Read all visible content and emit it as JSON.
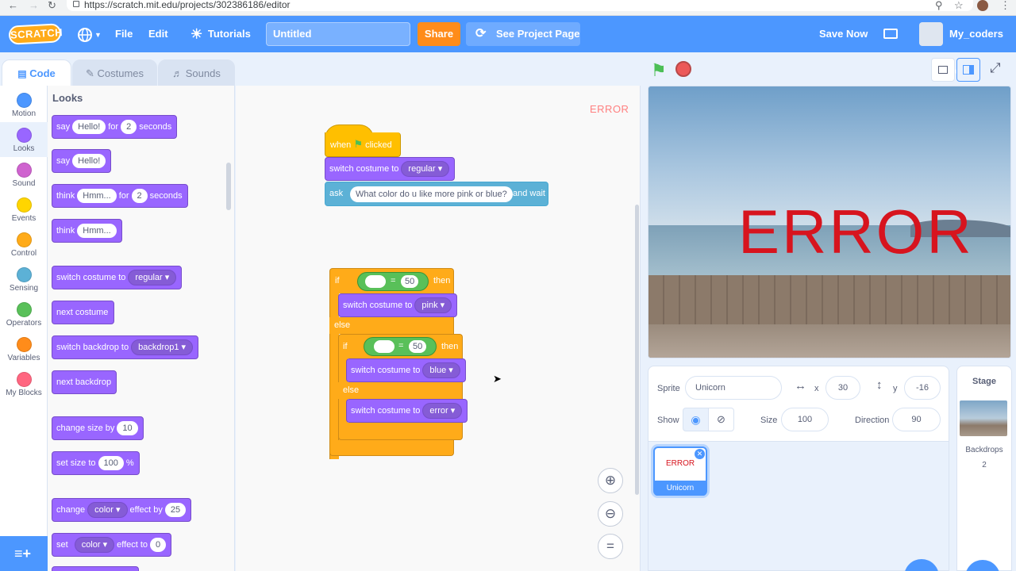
{
  "browser": {
    "url": "https://scratch.mit.edu/projects/302386186/editor"
  },
  "menu": {
    "logo": "SCRATCH",
    "file": "File",
    "edit": "Edit",
    "tutorials": "Tutorials",
    "project_title": "Untitled",
    "share": "Share",
    "see_project_page": "See Project Page",
    "save_now": "Save Now",
    "username": "My_coders"
  },
  "tabs": {
    "code": "Code",
    "costumes": "Costumes",
    "sounds": "Sounds"
  },
  "categories": [
    {
      "label": "Motion",
      "color": "#4c97ff"
    },
    {
      "label": "Looks",
      "color": "#9966ff"
    },
    {
      "label": "Sound",
      "color": "#cf63cf"
    },
    {
      "label": "Events",
      "color": "#ffd500"
    },
    {
      "label": "Control",
      "color": "#ffab19"
    },
    {
      "label": "Sensing",
      "color": "#5cb1d6"
    },
    {
      "label": "Operators",
      "color": "#59c059"
    },
    {
      "label": "Variables",
      "color": "#ff8c1a"
    },
    {
      "label": "My Blocks",
      "color": "#ff6680"
    }
  ],
  "palette": {
    "heading": "Looks",
    "say_for": {
      "say": "say",
      "text": "Hello!",
      "for": "for",
      "secs": "2",
      "seconds": "seconds"
    },
    "say": {
      "say": "say",
      "text": "Hello!"
    },
    "think_for": {
      "think": "think",
      "text": "Hmm...",
      "for": "for",
      "secs": "2",
      "seconds": "seconds"
    },
    "think": {
      "think": "think",
      "text": "Hmm..."
    },
    "switch_costume": {
      "label": "switch costume to",
      "value": "regular"
    },
    "next_costume": "next costume",
    "switch_backdrop": {
      "label": "switch backdrop to",
      "value": "backdrop1"
    },
    "next_backdrop": "next backdrop",
    "change_size": {
      "label": "change size by",
      "value": "10"
    },
    "set_size": {
      "label": "set size to",
      "value": "100",
      "unit": "%"
    },
    "change_effect": {
      "change": "change",
      "effect": "color",
      "by": "effect by",
      "value": "25"
    },
    "set_effect": {
      "set": "set",
      "effect": "color",
      "to": "effect to",
      "value": "0"
    }
  },
  "script": {
    "error_label": "ERROR",
    "when_clicked": {
      "when": "when",
      "clicked": "clicked"
    },
    "switch1": {
      "label": "switch costume to",
      "value": "regular"
    },
    "ask": {
      "ask": "ask",
      "question": "What color do u like more pink or blue?",
      "wait": "and wait"
    },
    "if1": {
      "if": "if",
      "eq": "=",
      "value": "50",
      "then": "then"
    },
    "switch_pink": {
      "label": "switch costume to",
      "value": "pink"
    },
    "else1": "else",
    "if2": {
      "if": "if",
      "eq": "=",
      "value": "50",
      "then": "then"
    },
    "switch_blue": {
      "label": "switch costume to",
      "value": "blue"
    },
    "else2": "else",
    "switch_error": {
      "label": "switch costume to",
      "value": "error"
    },
    "zoom_reset": "="
  },
  "stage": {
    "text": "ERROR",
    "text_color": "#d7141e"
  },
  "sprite_info": {
    "sprite_label": "Sprite",
    "sprite_name": "Unicorn",
    "x_label": "x",
    "x": "30",
    "y_label": "y",
    "y": "-16",
    "show_label": "Show",
    "size_label": "Size",
    "size": "100",
    "direction_label": "Direction",
    "direction": "90"
  },
  "sprite_list": [
    {
      "name": "Unicorn",
      "thumb_text": "ERROR"
    }
  ],
  "stage_target": {
    "title": "Stage",
    "backdrops_label": "Backdrops",
    "backdrops_count": "2"
  }
}
